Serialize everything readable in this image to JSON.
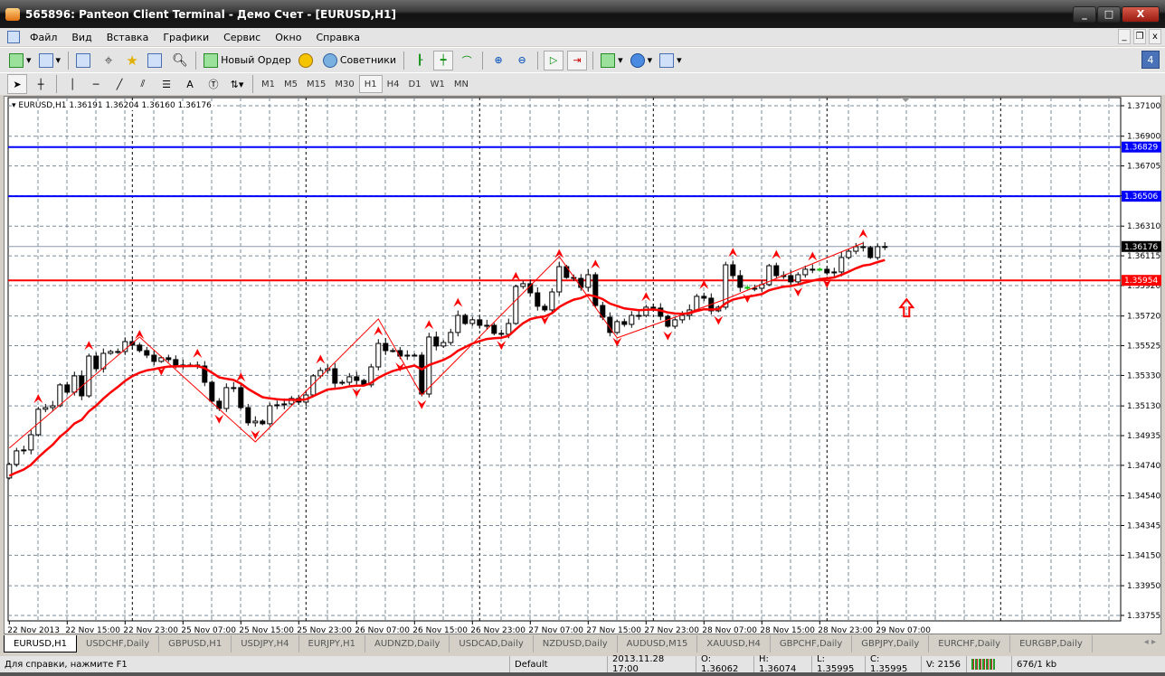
{
  "window": {
    "title": "565896: Panteon Client Terminal - Демо Счет - [EURUSD,H1]",
    "minimize": "_",
    "maximize": "□",
    "close": "X"
  },
  "menu": [
    "Файл",
    "Вид",
    "Вставка",
    "Графики",
    "Сервис",
    "Окно",
    "Справка"
  ],
  "mdi": {
    "minimize": "_",
    "restore": "❐",
    "close": "x"
  },
  "toolbar": {
    "new_order": "Новый Ордер",
    "experts": "Советники",
    "notifications_count": "4"
  },
  "timeframes": [
    "M1",
    "M5",
    "M15",
    "M30",
    "H1",
    "H4",
    "D1",
    "W1",
    "MN"
  ],
  "active_timeframe": "H1",
  "chart": {
    "symbol_info": "EURUSD,H1  1.36191 1.36204 1.36160 1.36176",
    "price_labels": [
      "1.37100",
      "1.36900",
      "1.36705",
      "1.36510",
      "1.36310",
      "1.36115",
      "1.35920",
      "1.35720",
      "1.35525",
      "1.35330",
      "1.35130",
      "1.34935",
      "1.34740",
      "1.34540",
      "1.34345",
      "1.34150",
      "1.33950",
      "1.33755"
    ],
    "time_labels": [
      "22 Nov 2013",
      "22 Nov 15:00",
      "22 Nov 23:00",
      "25 Nov 07:00",
      "25 Nov 15:00",
      "25 Nov 23:00",
      "26 Nov 07:00",
      "26 Nov 15:00",
      "26 Nov 23:00",
      "27 Nov 07:00",
      "27 Nov 15:00",
      "27 Nov 23:00",
      "28 Nov 07:00",
      "28 Nov 15:00",
      "28 Nov 23:00",
      "29 Nov 07:00"
    ],
    "hlines": [
      {
        "price": 1.36829,
        "label": "1.36829",
        "color": "#0000ff"
      },
      {
        "price": 1.36506,
        "label": "1.36506",
        "color": "#0000ff"
      },
      {
        "price": 1.35954,
        "label": "1.35954",
        "color": "#ff0000"
      }
    ],
    "bid": {
      "price": 1.36176,
      "label": "1.36176",
      "color": "#000000"
    }
  },
  "chart_data": {
    "type": "candlestick",
    "symbol": "EURUSD",
    "timeframe": "H1",
    "ylim": [
      1.33755,
      1.371
    ],
    "first_open": 1.34657,
    "close": [
      1.34746,
      1.34835,
      1.34841,
      1.34941,
      1.35108,
      1.35119,
      1.35131,
      1.35268,
      1.3522,
      1.35327,
      1.35196,
      1.35457,
      1.35374,
      1.35475,
      1.35487,
      1.35487,
      1.35552,
      1.35529,
      1.35493,
      1.35463,
      1.35422,
      1.35446,
      1.35434,
      1.35398,
      1.35398,
      1.35398,
      1.35392,
      1.35285,
      1.35161,
      1.35113,
      1.3525,
      1.3525,
      1.35119,
      1.35019,
      1.3503,
      1.35013,
      1.35131,
      1.35137,
      1.35143,
      1.35179,
      1.35155,
      1.35202,
      1.35327,
      1.35363,
      1.35374,
      1.35279,
      1.35285,
      1.35321,
      1.35297,
      1.35268,
      1.35386,
      1.3554,
      1.35493,
      1.35493,
      1.35457,
      1.35463,
      1.35463,
      1.35208,
      1.35582,
      1.35523,
      1.35546,
      1.35612,
      1.35724,
      1.35671,
      1.35695,
      1.35659,
      1.35659,
      1.35606,
      1.356,
      1.35671,
      1.35914,
      1.35932,
      1.35872,
      1.35784,
      1.3576,
      1.35878,
      1.36044,
      1.35973,
      1.35967,
      1.35908,
      1.35991,
      1.35789,
      1.35712,
      1.35612,
      1.35683,
      1.35665,
      1.35724,
      1.35724,
      1.35778,
      1.35772,
      1.35718,
      1.35653,
      1.35695,
      1.35724,
      1.3576,
      1.35849,
      1.35837,
      1.35754,
      1.35778,
      1.36056,
      1.35985,
      1.35908,
      1.35902,
      1.35902,
      1.35926,
      1.3605,
      1.35985,
      1.35985,
      1.35944,
      1.35991,
      1.36027,
      1.36027,
      1.36027,
      1.36003,
      1.36009,
      1.36104,
      1.36145,
      1.36175,
      1.36169,
      1.36104,
      1.36175,
      1.36176
    ],
    "green_bars": [
      102,
      112
    ],
    "zigzag": [
      [
        0,
        1.34853
      ],
      [
        18,
        1.35582
      ],
      [
        34,
        1.34894
      ],
      [
        51,
        1.35701
      ],
      [
        57,
        1.35202
      ],
      [
        76,
        1.3611
      ],
      [
        84,
        1.35576
      ],
      [
        99,
        1.35831
      ],
      [
        118,
        1.36199
      ]
    ],
    "fractal_up_bars": [
      4,
      11,
      18,
      26,
      32,
      43,
      51,
      58,
      62,
      70,
      76,
      81,
      88,
      96,
      100,
      106,
      111,
      118
    ],
    "fractal_down_bars": [
      21,
      29,
      34,
      48,
      54,
      57,
      68,
      74,
      84,
      91,
      98,
      102,
      109,
      113
    ],
    "moving_average_color": "#ff0000",
    "signal_arrow": "up",
    "colors": {
      "bull_body": "#ffffff",
      "bear_body": "#000000",
      "grid": "#7a8a9a",
      "zigzag": "#ff0000",
      "fractals": "#ff0000"
    }
  },
  "tabs": [
    "EURUSD,H1",
    "USDCHF,Daily",
    "GBPUSD,H1",
    "USDJPY,H4",
    "EURJPY,H1",
    "AUDNZD,Daily",
    "USDCAD,Daily",
    "NZDUSD,Daily",
    "AUDUSD,M15",
    "XAUUSD,H4",
    "GBPCHF,Daily",
    "GBPJPY,Daily",
    "EURCHF,Daily",
    "EURGBP,Daily"
  ],
  "tab_scroll": "◂ ▸",
  "status": {
    "help": "Для справки, нажмите F1",
    "profile": "Default",
    "datetime": "2013.11.28 17:00",
    "open": "O: 1.36062",
    "high": "H: 1.36074",
    "low": "L: 1.35995",
    "close": "C: 1.35995",
    "volume": "V: 2156",
    "traffic": "676/1 kb"
  }
}
